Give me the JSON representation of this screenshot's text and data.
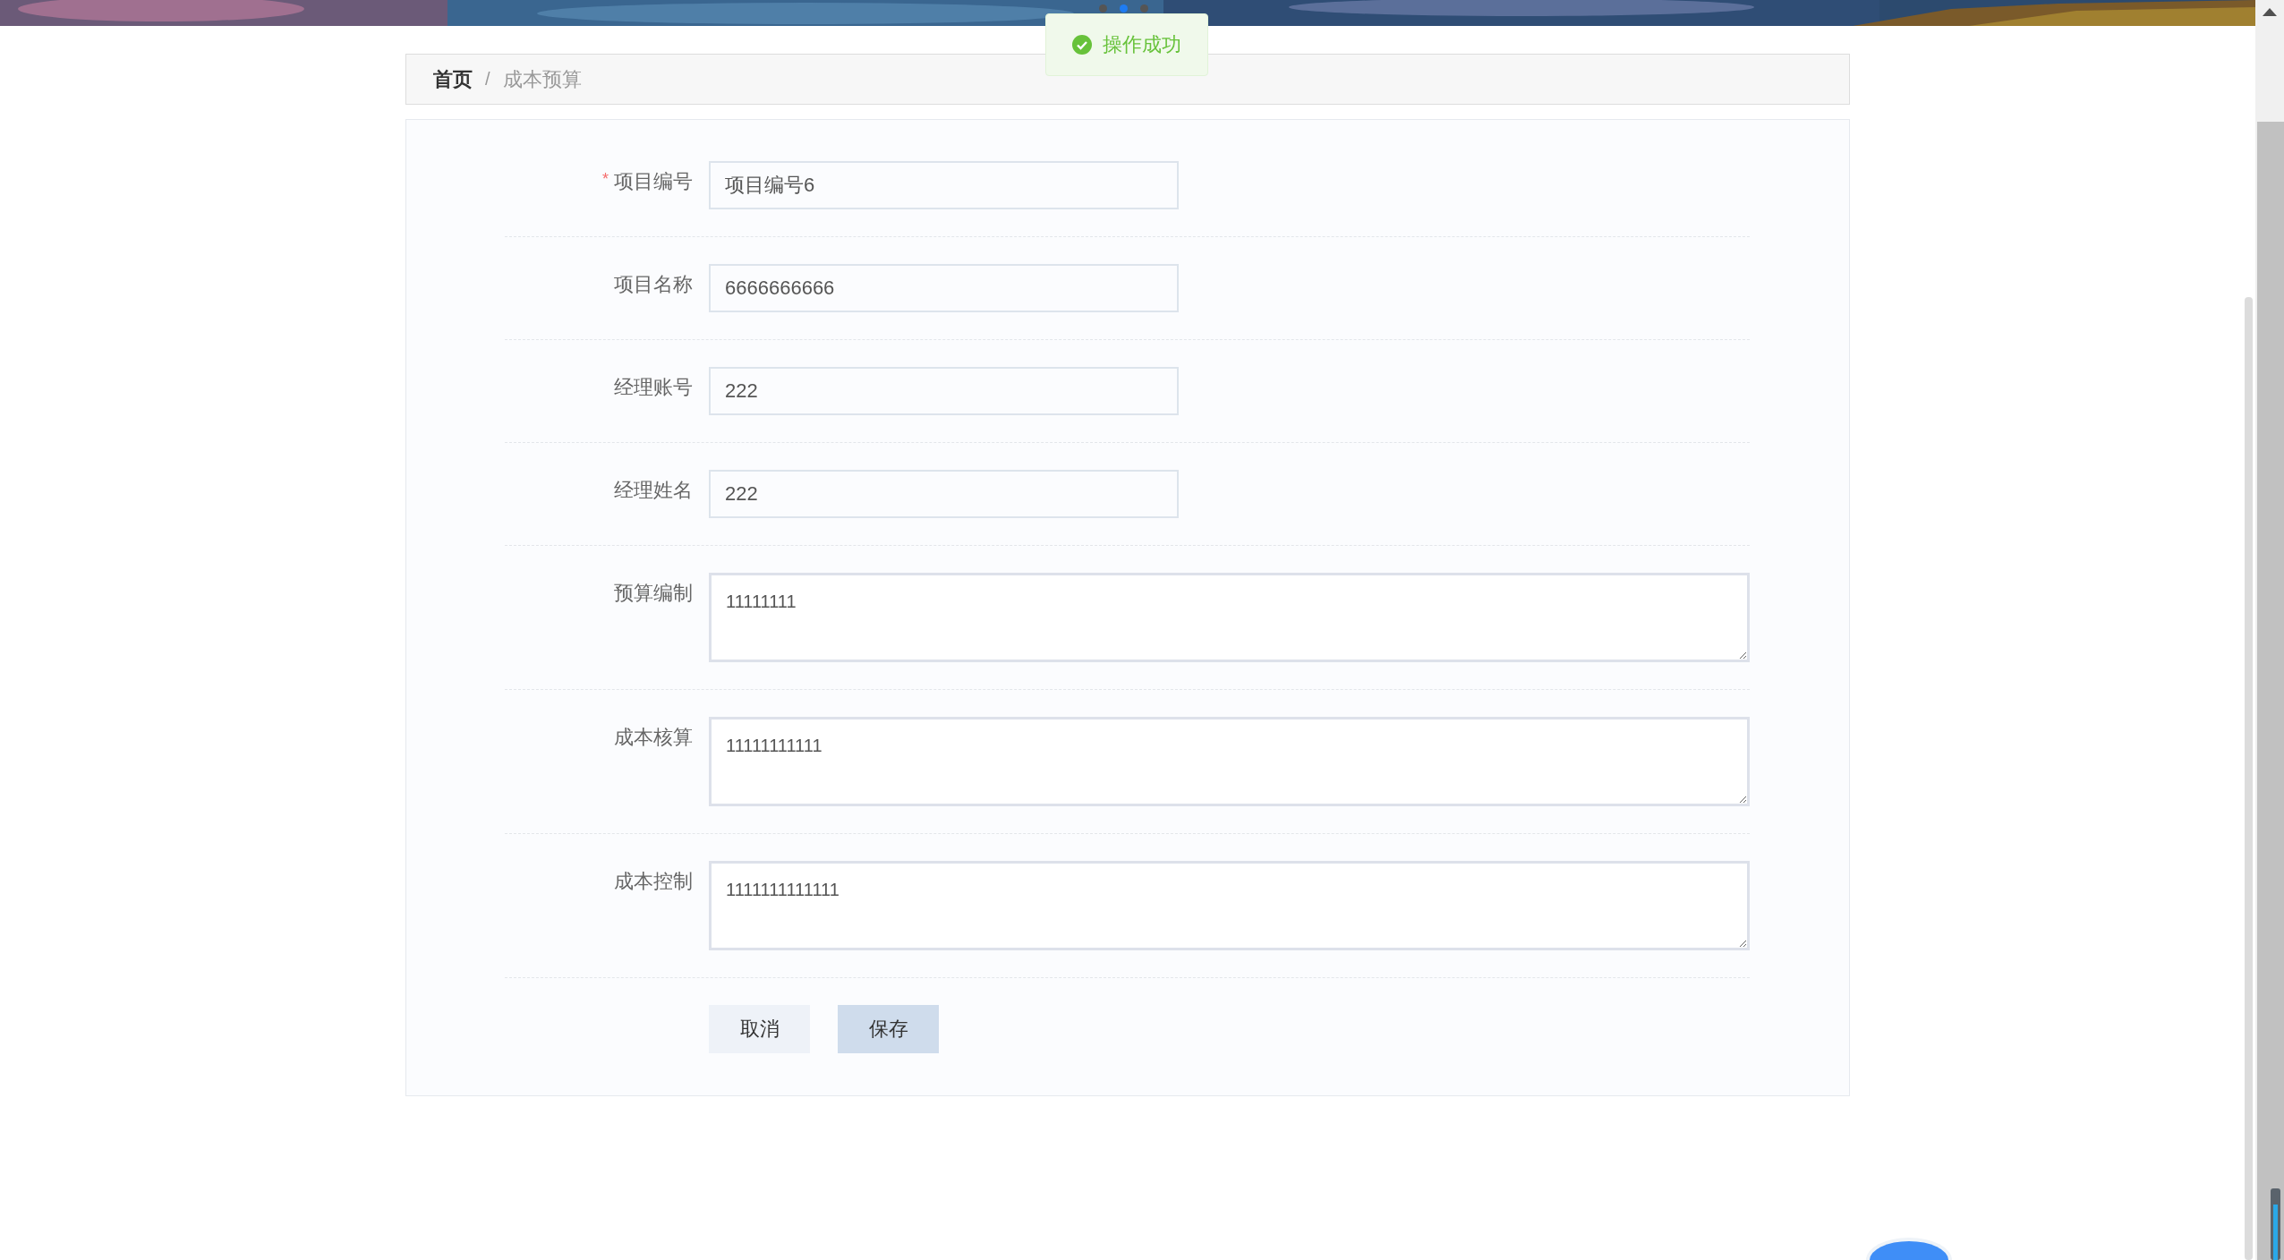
{
  "carousel_dots": [
    {
      "selected": false
    },
    {
      "selected": true
    },
    {
      "selected": false
    }
  ],
  "toast": {
    "text": "操作成功"
  },
  "breadcrumb": {
    "separator": "/",
    "items": [
      {
        "label": "首页",
        "current": false
      },
      {
        "label": "成本预算",
        "current": true
      }
    ]
  },
  "form": {
    "fields": [
      {
        "label": "项目编号",
        "marker": "*",
        "kind": "input",
        "value": "项目编号6"
      },
      {
        "label": "项目名称",
        "kind": "input",
        "value": "6666666666"
      },
      {
        "label": "经理账号",
        "kind": "input",
        "value": "222"
      },
      {
        "label": "经理姓名",
        "kind": "input",
        "value": "222"
      },
      {
        "label": "预算编制",
        "kind": "textarea",
        "value": "11111111"
      },
      {
        "label": "成本核算",
        "kind": "textarea",
        "value": "11111111111"
      },
      {
        "label": "成本控制",
        "kind": "textarea",
        "value": "1111111111111"
      }
    ],
    "buttons": [
      {
        "label": "取消",
        "primary": false
      },
      {
        "label": "保存",
        "primary": true
      }
    ]
  }
}
